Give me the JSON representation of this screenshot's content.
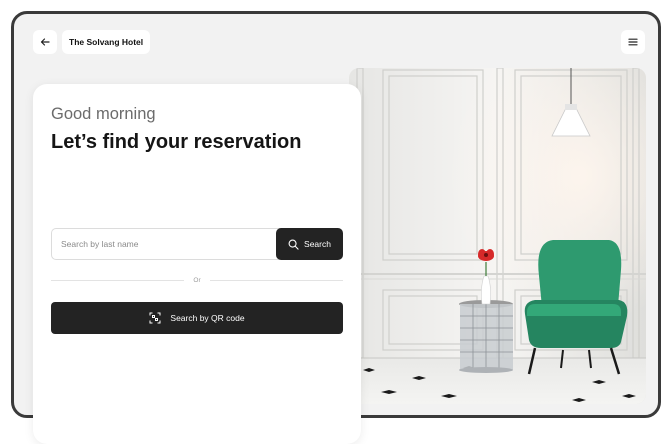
{
  "header": {
    "back_icon": "arrow-left-icon",
    "hotel_name": "The Solvang Hotel",
    "menu_icon": "hamburger-menu-icon"
  },
  "card": {
    "greeting": "Good morning",
    "headline": "Let’s find your reservation",
    "search": {
      "placeholder": "Search by last name",
      "value": "",
      "button_label": "Search",
      "button_icon": "search-icon"
    },
    "divider_label": "Or",
    "qr_button": {
      "label": "Search by QR code",
      "icon": "qr-scan-icon"
    }
  },
  "photo": {
    "subject": "lobby-photo"
  },
  "colors": {
    "button_dark": "#232323",
    "chair_green": "#2e9a6f",
    "flower_red": "#d62a2a",
    "device_frame": "#3a3a3a"
  }
}
